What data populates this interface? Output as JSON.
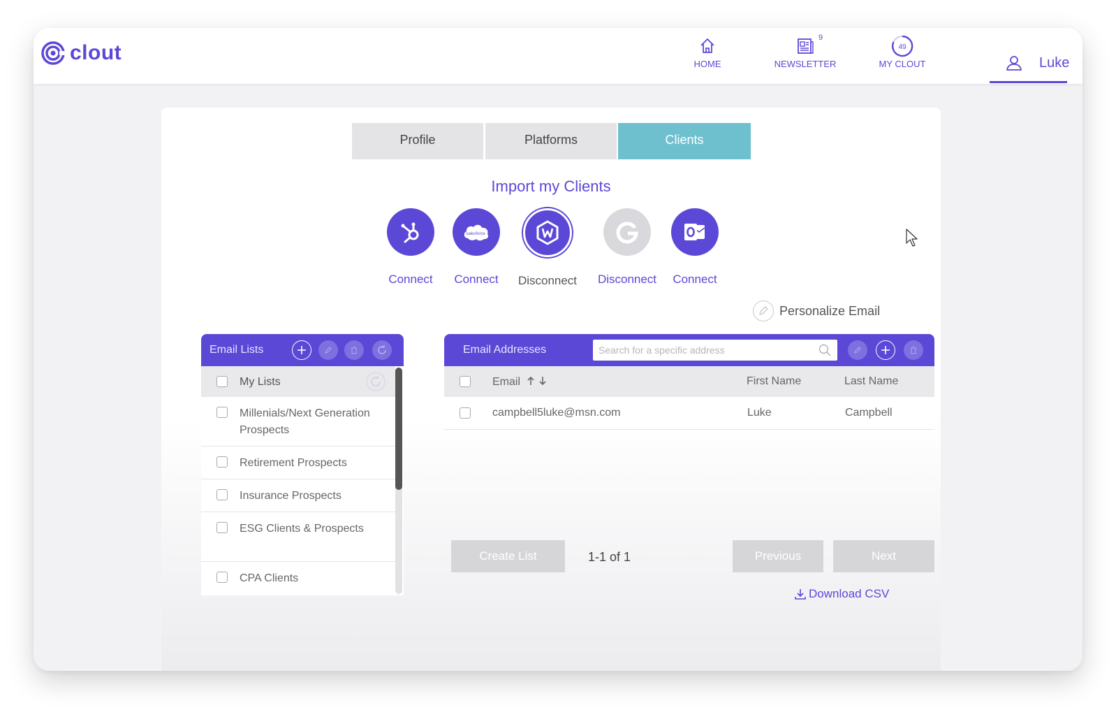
{
  "app": {
    "logo_text": "clout"
  },
  "nav": {
    "home_label": "HOME",
    "newsletter_label": "NEWSLETTER",
    "newsletter_badge": "9",
    "myclout_label": "MY CLOUT",
    "myclout_score": "49",
    "user_name": "Luke"
  },
  "tabs": [
    {
      "label": "Profile",
      "active": false
    },
    {
      "label": "Platforms",
      "active": false
    },
    {
      "label": "Clients",
      "active": true
    }
  ],
  "import": {
    "title": "Import my Clients",
    "providers": [
      {
        "icon": "hubspot-icon",
        "label": "Connect"
      },
      {
        "icon": "salesforce-icon",
        "label": "Connect"
      },
      {
        "icon": "wealthbox-icon",
        "label": "Disconnect"
      },
      {
        "icon": "google-icon",
        "label": "Disconnect"
      },
      {
        "icon": "outlook-icon",
        "label": "Connect"
      }
    ]
  },
  "personalize_label": "Personalize Email",
  "email_lists": {
    "title": "Email Lists",
    "subheader": "My Lists",
    "items": [
      "Millenials/Next Generation Prospects",
      "Retirement Prospects",
      "Insurance Prospects",
      "ESG Clients & Prospects",
      "CPA Clients"
    ]
  },
  "email_addresses": {
    "title": "Email Addresses",
    "search_placeholder": "Search for a specific address",
    "columns": {
      "email": "Email",
      "first_name": "First Name",
      "last_name": "Last Name"
    },
    "rows": [
      {
        "email": "campbell5luke@msn.com",
        "first_name": "Luke",
        "last_name": "Campbell"
      }
    ]
  },
  "buttons": {
    "create_list": "Create List",
    "previous": "Previous",
    "next": "Next",
    "download_csv": "Download CSV"
  },
  "pagination": "1-1 of 1",
  "colors": {
    "accent": "#5b48d6",
    "tab_active": "#6fc0cf",
    "disabled": "#d6d6d9"
  }
}
